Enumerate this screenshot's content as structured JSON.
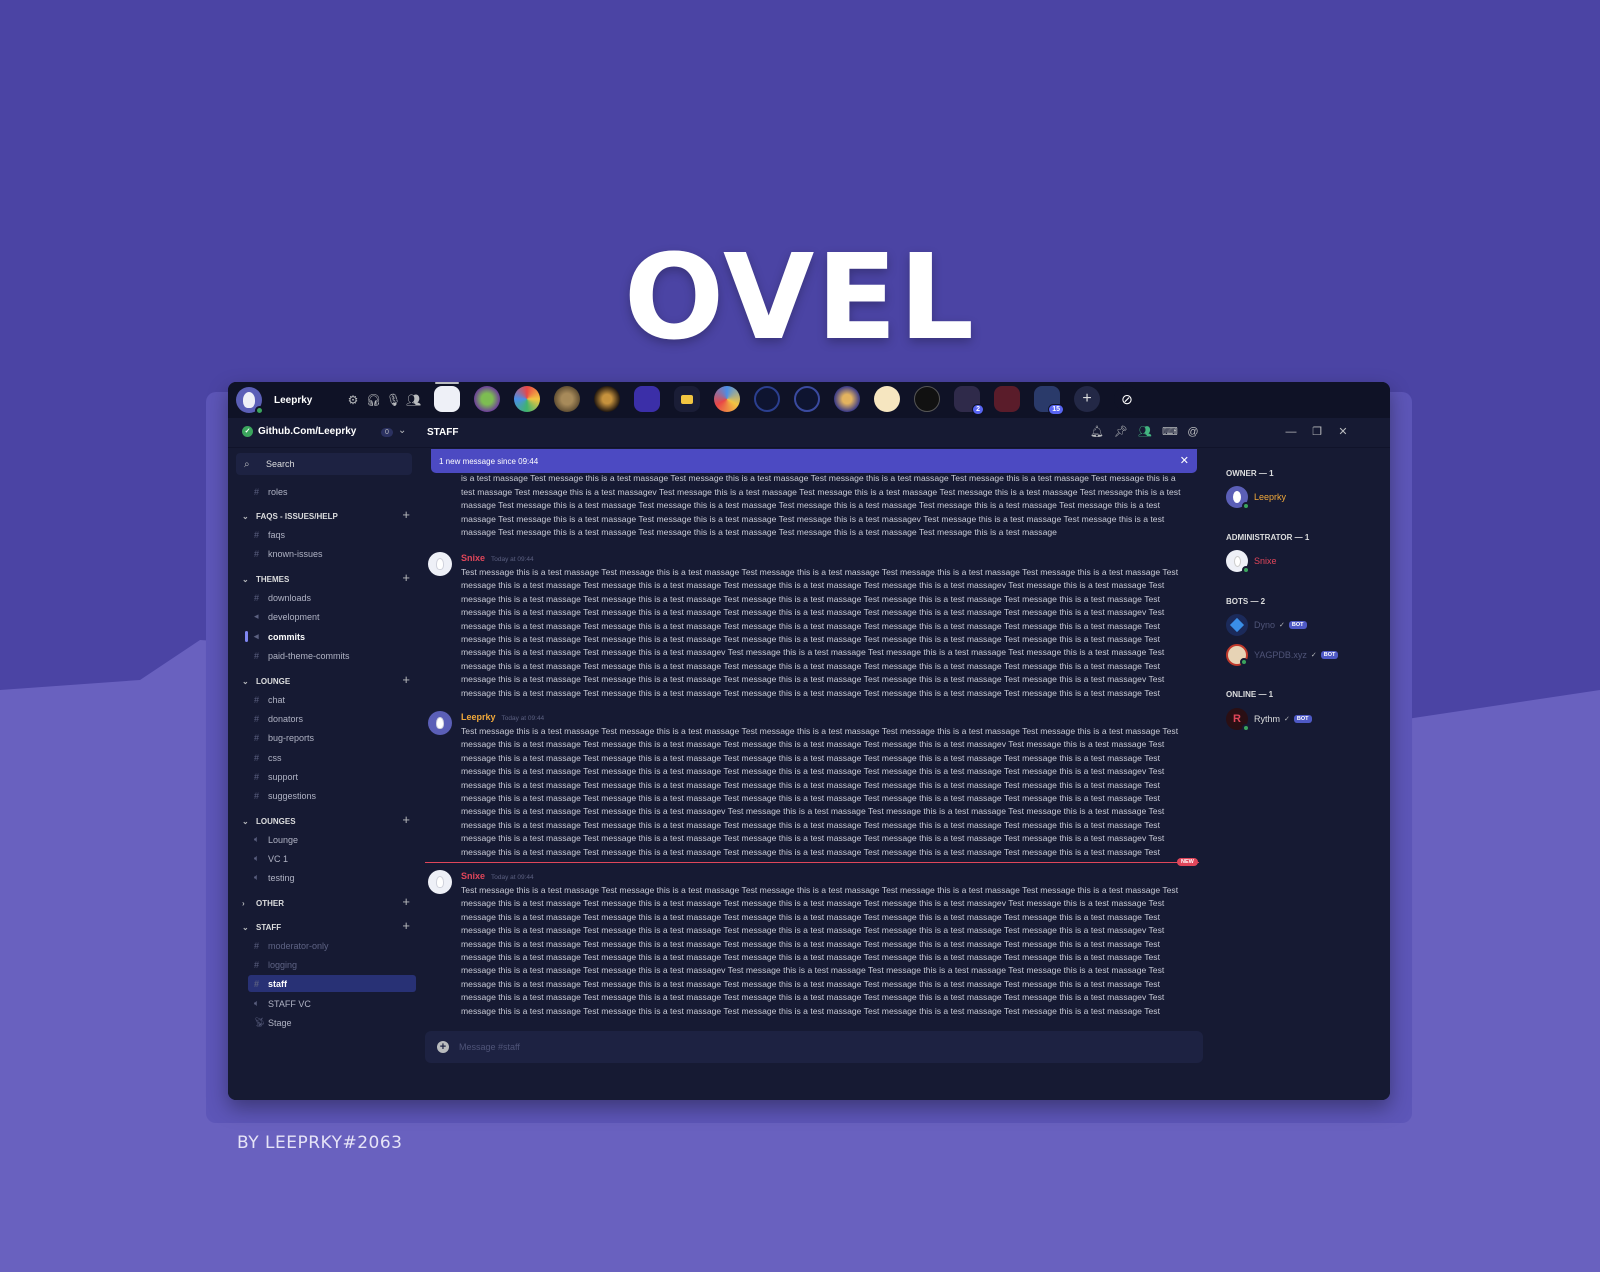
{
  "hero": {
    "title": "OVEL",
    "credit": "BY LEEPRKY#2063"
  },
  "colors": {
    "background": "#4b44a4",
    "window": "#161a33",
    "accent": "#4c4ac2",
    "online": "#3ba55d",
    "mention": "#e0465a"
  },
  "user_panel": {
    "username": "Leeprky",
    "icons": [
      "settings-icon",
      "headphones-icon",
      "microphone-icon",
      "friends-icon"
    ]
  },
  "guild_badges": {
    "g14": "2",
    "g16": "15"
  },
  "server": {
    "name": "Github.Com/Leeprky",
    "count": "0"
  },
  "channel_header": {
    "title": "STAFF",
    "icons": [
      "bell-icon",
      "pin-icon",
      "members-icon",
      "keyboard-icon",
      "mention-icon"
    ]
  },
  "sidebar": {
    "search_placeholder": "Search",
    "top_channels": [
      "roles"
    ],
    "categories": [
      {
        "name": "FAQS - ISSUES/HELP",
        "channels": [
          "faqs",
          "known-issues"
        ]
      },
      {
        "name": "THEMES",
        "channels": [
          "downloads",
          "development",
          "commits",
          "paid-theme-commits"
        ]
      },
      {
        "name": "LOUNGE",
        "channels": [
          "chat",
          "donators",
          "bug-reports",
          "css",
          "support",
          "suggestions"
        ]
      },
      {
        "name": "LOUNGES",
        "channels": [
          "Lounge",
          "VC 1",
          "testing"
        ]
      },
      {
        "name": "OTHER",
        "channels": []
      },
      {
        "name": "STAFF",
        "channels": [
          "moderator-only",
          "logging",
          "staff",
          "STAFF VC",
          "Stage"
        ]
      }
    ]
  },
  "chat": {
    "banner": "1 new message since 09:44",
    "partial_message": "this is a test massage Test message this is a test massage Test message this is a test massage Test message this is a test massage Test message this is a test massage Test message this is a test massage Test message this is a test massage Test message this is a test massage Test message this is a test massage Test message this is a test massage Test message this is a test massage Test message this is a test massagev Test message this is a test massage Test message this is a test massage Test message this is a test massage Test message this is a test massage Test message this is a test massage Test message this is a test massage Test message this is a test massage Test message this is a test massage Test message this is a test massage Test message this is a test massage Test message this is a test massage Test message this is a test massagev Test message this is a test massage Test message this is a test massage Test message this is a test massage Test message this is a test massage Test message this is a test massage Test message this is a test massage",
    "messages": [
      {
        "author": "Snixe",
        "time": "Today at 09:44",
        "text": "Test message this is a test massage Test message this is a test massage Test message this is a test massage Test message this is a test massage Test message this is a test massage Test message this is a test massage Test message this is a test massage Test message this is a test massage Test message this is a test massagev Test message this is a test massage Test message this is a test massage Test message this is a test massage Test message this is a test massage Test message this is a test massage Test message this is a test massage Test message this is a test massage Test message this is a test massage Test message this is a test massage Test message this is a test massage Test message this is a test massagev Test message this is a test massage Test message this is a test massage Test message this is a test massage Test message this is a test massage Test message this is a test massage Test message this is a test massage Test message this is a test massage Test message this is a test massage Test message this is a test massage Test message this is a test massage Test message this is a test massage Test message this is a test massagev Test message this is a test massage Test message this is a test massage Test message this is a test massage Test message this is a test massage Test message this is a test massage Test message this is a test massage Test message this is a test massage Test message this is a test massage Test message this is a test massage Test message this is a test massage Test message this is a test massage Test message this is a test massage Test message this is a test massagev Test message this is a test massage Test message this is a test massage Test message this is a test massage Test message this is a test massage Test message this is a test massage Test message this is a test massage"
      },
      {
        "author": "Leeprky",
        "time": "Today at 09:44",
        "text": "Test message this is a test massage Test message this is a test massage Test message this is a test massage Test message this is a test massage Test message this is a test massage Test message this is a test massage Test message this is a test massage Test message this is a test massage Test message this is a test massagev Test message this is a test massage Test message this is a test massage Test message this is a test massage Test message this is a test massage Test message this is a test massage Test message this is a test massage Test message this is a test massage Test message this is a test massage Test message this is a test massage Test message this is a test massage Test message this is a test massagev Test message this is a test massage Test message this is a test massage Test message this is a test massage Test message this is a test massage Test message this is a test massage Test message this is a test massage Test message this is a test massage Test message this is a test massage Test message this is a test massage Test message this is a test massage Test message this is a test massage Test message this is a test massagev Test message this is a test massage Test message this is a test massage Test message this is a test massage Test message this is a test massage Test message this is a test massage Test message this is a test massage Test message this is a test massage Test message this is a test massage Test message this is a test massage Test message this is a test massage Test message this is a test massage Test message this is a test massage Test message this is a test massagev Test message this is a test massage Test message this is a test massage Test message this is a test massage Test message this is a test massage Test message this is a test massage Test message this is a test massage"
      },
      {
        "author": "Snixe",
        "time": "Today at 09:44",
        "text": "Test message this is a test massage Test message this is a test massage Test message this is a test massage Test message this is a test massage Test message this is a test massage Test message this is a test massage Test message this is a test massage Test message this is a test massage Test message this is a test massagev Test message this is a test massage Test message this is a test massage Test message this is a test massage Test message this is a test massage Test message this is a test massage Test message this is a test massage Test message this is a test massage Test message this is a test massage Test message this is a test massage Test message this is a test massage Test message this is a test massagev Test message this is a test massage Test message this is a test massage Test message this is a test massage Test message this is a test massage Test message this is a test massage Test message this is a test massage Test message this is a test massage Test message this is a test massage Test message this is a test massage Test message this is a test massage Test message this is a test massage Test message this is a test massagev Test message this is a test massage Test message this is a test massage Test message this is a test massage Test message this is a test massage Test message this is a test massage Test message this is a test massage Test message this is a test massage Test message this is a test massage Test message this is a test massage Test message this is a test massage Test message this is a test massage Test message this is a test massage Test message this is a test massagev Test message this is a test massage Test message this is a test massage Test message this is a test massage Test message this is a test massage Test message this is a test massage Test message this is a test massage"
      }
    ],
    "new_tag": "NEW",
    "composer_placeholder": "Message #staff"
  },
  "members": {
    "groups": [
      {
        "label": "OWNER — 1",
        "members": [
          {
            "name": "Leeprky"
          }
        ]
      },
      {
        "label": "ADMINISTRATOR — 1",
        "members": [
          {
            "name": "Snixe"
          }
        ]
      },
      {
        "label": "BOTS — 2",
        "members": [
          {
            "name": "Dyno",
            "tag": "BOT"
          },
          {
            "name": "YAGPDB.xyz",
            "tag": "BOT"
          }
        ]
      },
      {
        "label": "ONLINE — 1",
        "members": [
          {
            "name": "Rythm",
            "tag": "BOT"
          }
        ]
      }
    ]
  }
}
